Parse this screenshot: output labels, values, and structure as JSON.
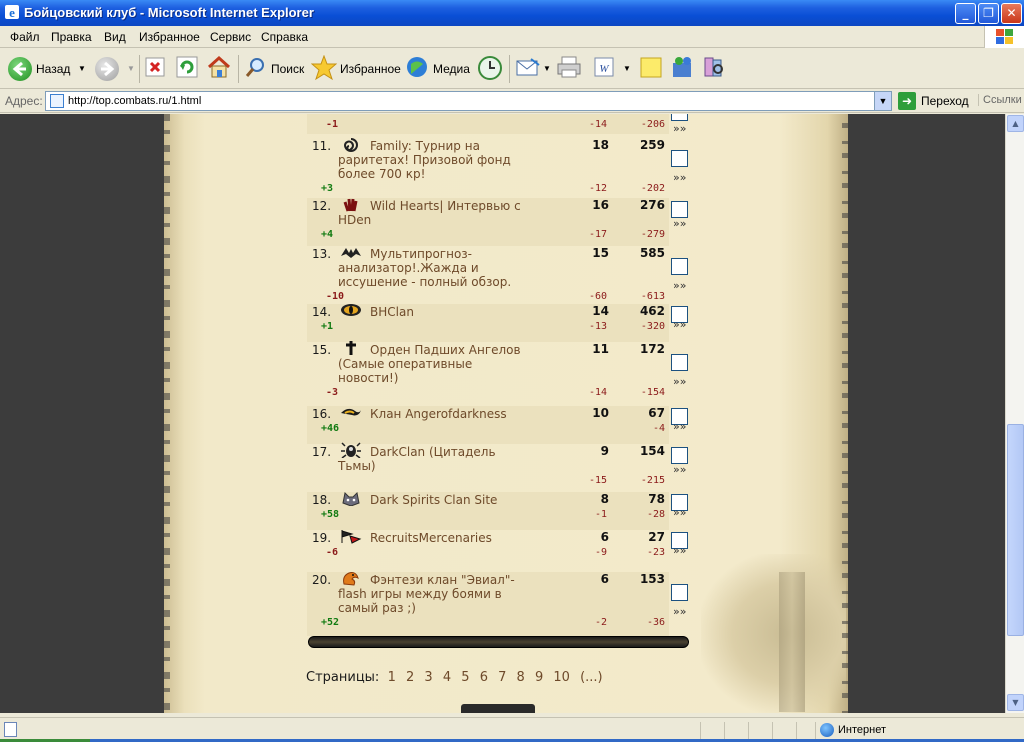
{
  "window": {
    "title": "Бойцовский клуб - Microsoft Internet Explorer"
  },
  "menu": [
    "Файл",
    "Правка",
    "Вид",
    "Избранное",
    "Сервис",
    "Справка"
  ],
  "toolbar": {
    "back": "Назад",
    "search": "Поиск",
    "favorites": "Избранное",
    "media": "Медиа"
  },
  "address": {
    "label": "Адрес:",
    "url": "http://top.combats.ru/1.html",
    "go": "Переход",
    "links": "Ссылки"
  },
  "ranking": {
    "top_stub": {
      "delta": "-1",
      "d1": "-14",
      "d2": "-206"
    },
    "rows": [
      {
        "rank": "11.",
        "icon": "spiral-clan-icon",
        "name": "Family: Турнир на раритетах! Призовой фонд более 700 кр!",
        "today": "18",
        "total": "259",
        "delta": "+3",
        "d1": "-12",
        "d2": "-202"
      },
      {
        "rank": "12.",
        "icon": "red-hand-clan-icon",
        "name": "Wild Hearts| Интервью с HDen",
        "today": "16",
        "total": "276",
        "delta": "+4",
        "d1": "-17",
        "d2": "-279"
      },
      {
        "rank": "13.",
        "icon": "bat-clan-icon",
        "name": "Мультипрогноз-анализатор!.Жажда и иссушение - полный обзор.",
        "today": "15",
        "total": "585",
        "delta": "-10",
        "d1": "-60",
        "d2": "-613"
      },
      {
        "rank": "14.",
        "icon": "eye-clan-icon",
        "name": "BHClan",
        "today": "14",
        "total": "462",
        "delta": "+1",
        "d1": "-13",
        "d2": "-320"
      },
      {
        "rank": "15.",
        "icon": "cross-clan-icon",
        "name": "Орден Падших Ангелов (Самые оперативные новости!)",
        "today": "11",
        "total": "172",
        "delta": "-3",
        "d1": "-14",
        "d2": "-154"
      },
      {
        "rank": "16.",
        "icon": "flame-clan-icon",
        "name": "Клан Angerofdarkness",
        "today": "10",
        "total": "67",
        "delta": "+46",
        "d1": "",
        "d2": "-4"
      },
      {
        "rank": "17.",
        "icon": "beetle-clan-icon",
        "name": "DarkClan (Цитадель Тьмы)",
        "today": "9",
        "total": "154",
        "delta": "",
        "d1": "-15",
        "d2": "-215"
      },
      {
        "rank": "18.",
        "icon": "wolf-clan-icon",
        "name": "Dark Spirits Clan Site",
        "today": "8",
        "total": "78",
        "delta": "+58",
        "d1": "-1",
        "d2": "-28"
      },
      {
        "rank": "19.",
        "icon": "flags-clan-icon",
        "name": "RecruitsMercenaries",
        "today": "6",
        "total": "27",
        "delta": "-6",
        "d1": "-9",
        "d2": "-23"
      },
      {
        "rank": "20.",
        "icon": "dragon-clan-icon",
        "name": "Фэнтези клан \"Эвиал\"-flash игры между боями в самый раз ;)",
        "today": "6",
        "total": "153",
        "delta": "+52",
        "d1": "-2",
        "d2": "-36"
      }
    ],
    "more_glyph": "»»"
  },
  "pager": {
    "label": "Страницы:",
    "pages": [
      "1",
      "2",
      "3",
      "4",
      "5",
      "6",
      "7",
      "8",
      "9",
      "10",
      "(...)"
    ]
  },
  "status": {
    "zone": "Интернет"
  },
  "colors": {
    "positive": "#117A11",
    "negative": "#8B1A1A",
    "name": "#6E4A2A"
  }
}
